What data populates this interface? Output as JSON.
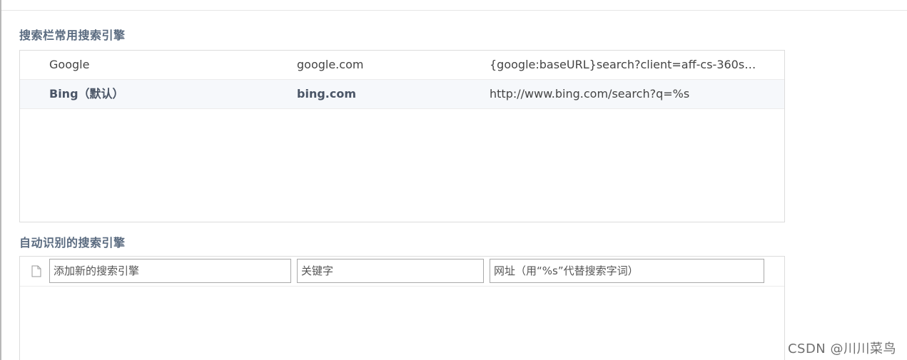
{
  "sections": {
    "common": {
      "title": "搜索栏常用搜索引擎",
      "engines": [
        {
          "icon": "google-icon",
          "name": "Google",
          "keyword": "google.com",
          "url": "{google:baseURL}search?client=aff-cs-360se&i..."
        },
        {
          "icon": "bing-icon",
          "name": "Bing（默认）",
          "keyword": "bing.com",
          "url": "http://www.bing.com/search?q=%s",
          "is_default": true
        }
      ]
    },
    "auto": {
      "title": "自动识别的搜索引擎",
      "new_name_placeholder": "添加新的搜索引擎",
      "new_keyword_placeholder": "关键字",
      "new_url_placeholder": "网址（用“%s”代替搜索字词）"
    }
  },
  "colors": {
    "section_title": "#5a6b80",
    "bing_brand": "#138a8a",
    "default_row_bg": "#f6f8fb"
  },
  "watermark": "CSDN @川川菜鸟"
}
